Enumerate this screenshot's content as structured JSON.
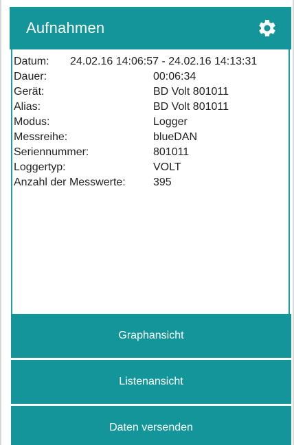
{
  "appbar": {
    "title": "Aufnahmen",
    "settings_icon": "gear-icon",
    "color": "#13959a"
  },
  "details": {
    "date": {
      "label": "Datum:",
      "value": "24.02.16 14:06:57 - 24.02.16 14:13:31"
    },
    "rows": [
      {
        "label": "Dauer:",
        "value": "00:06:34"
      },
      {
        "label": "Gerät:",
        "value": "BD Volt 801011"
      },
      {
        "label": "Alias:",
        "value": "BD Volt 801011"
      },
      {
        "label": "Modus:",
        "value": "Logger"
      },
      {
        "label": "Messreihe:",
        "value": "blueDAN"
      },
      {
        "label": "Seriennummer:",
        "value": "801011"
      },
      {
        "label": "Loggertyp:",
        "value": "VOLT"
      },
      {
        "label": "Anzahl der Messwerte:",
        "value": "395"
      }
    ]
  },
  "actions": {
    "graph": "Graphansicht",
    "list": "Listenansicht",
    "send": "Daten versenden"
  }
}
